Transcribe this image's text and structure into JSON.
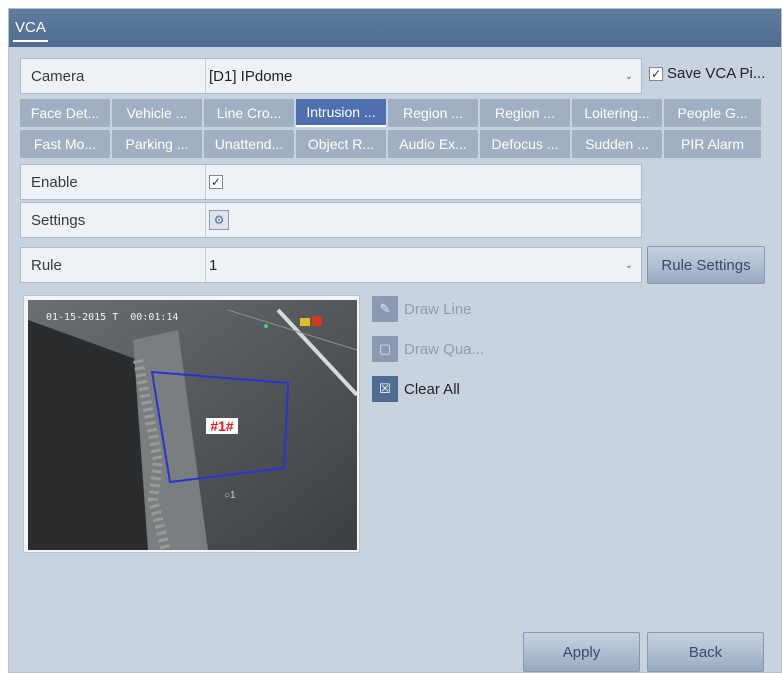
{
  "title": "VCA",
  "camera": {
    "label": "Camera",
    "value": "[D1] IPdome"
  },
  "save_vca": {
    "label": "Save VCA Pi...",
    "checked": true
  },
  "vca_tabs": [
    [
      "Face Det...",
      "Vehicle ...",
      "Line Cro...",
      "Intrusion ...",
      "Region ...",
      "Region ...",
      "Loitering...",
      "People G..."
    ],
    [
      "Fast Mo...",
      "Parking ...",
      "Unattend...",
      "Object R...",
      "Audio Ex...",
      "Defocus ...",
      "Sudden ...",
      "PIR Alarm"
    ]
  ],
  "active_tab": "Intrusion ...",
  "enable": {
    "label": "Enable",
    "checked": true
  },
  "settings": {
    "label": "Settings"
  },
  "rule": {
    "label": "Rule",
    "value": "1"
  },
  "rule_settings_label": "Rule Settings",
  "preview": {
    "timestamp": "01-15-2015 T  00:01:14",
    "region_label": "#1#",
    "channel_text": "○1"
  },
  "draw_tools": {
    "draw_line": "Draw Line",
    "draw_quad": "Draw Qua...",
    "clear_all": "Clear All"
  },
  "footer": {
    "apply": "Apply",
    "back": "Back"
  },
  "colors": {
    "header": "#56749a",
    "panel": "#c9d3e0",
    "tab": "#a0afc2",
    "active_tab": "#4f6fb0"
  }
}
